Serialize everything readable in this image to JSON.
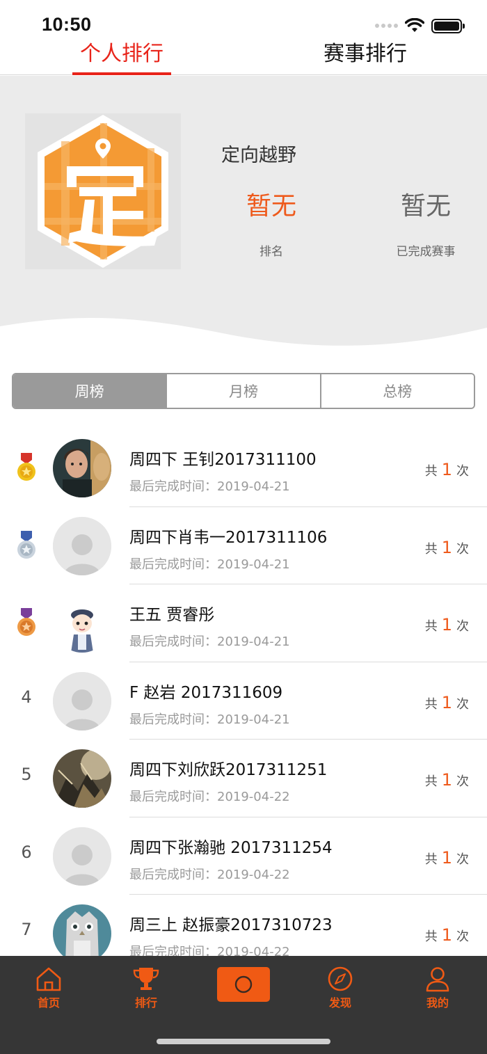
{
  "status_bar": {
    "time": "10:50"
  },
  "top_tabs": {
    "personal": "个人排行",
    "event": "赛事排行"
  },
  "header": {
    "event_name": "定向越野",
    "rank_value": "暂无",
    "rank_label": "排名",
    "completed_value": "暂无",
    "completed_label": "已完成赛事"
  },
  "segments": {
    "week": "周榜",
    "month": "月榜",
    "total": "总榜",
    "selected": "周榜"
  },
  "ranking": [
    {
      "rank": "1",
      "medal": "gold",
      "avatar": "photo-man-icon",
      "name": "周四下 王钊2017311100",
      "time": "最后完成时间：2019-04-21",
      "count_prefix": "共",
      "count": "1",
      "count_suffix": "次"
    },
    {
      "rank": "2",
      "medal": "silver",
      "avatar": "default-user-icon",
      "name": "周四下肖韦一2017311106",
      "time": "最后完成时间：2019-04-21",
      "count_prefix": "共",
      "count": "1",
      "count_suffix": "次"
    },
    {
      "rank": "3",
      "medal": "bronze",
      "avatar": "cartoon-boy-icon",
      "name": "王五 贾睿彤",
      "time": "最后完成时间：2019-04-21",
      "count_prefix": "共",
      "count": "1",
      "count_suffix": "次"
    },
    {
      "rank": "4",
      "medal": "",
      "avatar": "default-user-icon",
      "name": "F 赵岩 2017311609",
      "time": "最后完成时间：2019-04-21",
      "count_prefix": "共",
      "count": "1",
      "count_suffix": "次"
    },
    {
      "rank": "5",
      "medal": "",
      "avatar": "photo-scene-icon",
      "name": "周四下刘欣跃2017311251",
      "time": "最后完成时间：2019-04-22",
      "count_prefix": "共",
      "count": "1",
      "count_suffix": "次"
    },
    {
      "rank": "6",
      "medal": "",
      "avatar": "default-user-icon",
      "name": "周四下张瀚驰 2017311254",
      "time": "最后完成时间：2019-04-22",
      "count_prefix": "共",
      "count": "1",
      "count_suffix": "次"
    },
    {
      "rank": "7",
      "medal": "",
      "avatar": "owl-icon",
      "name": "周三上 赵振豪2017310723",
      "time": "最后完成时间：2019-04-22",
      "count_prefix": "共",
      "count": "1",
      "count_suffix": "次"
    }
  ],
  "bottom_nav": {
    "home": "首页",
    "rank": "排行",
    "discover": "发现",
    "mine": "我的"
  },
  "colors": {
    "accent": "#e8241a",
    "orange": "#ee5a1c",
    "nav_bg": "#363636",
    "header_bg": "#ebebeb"
  }
}
